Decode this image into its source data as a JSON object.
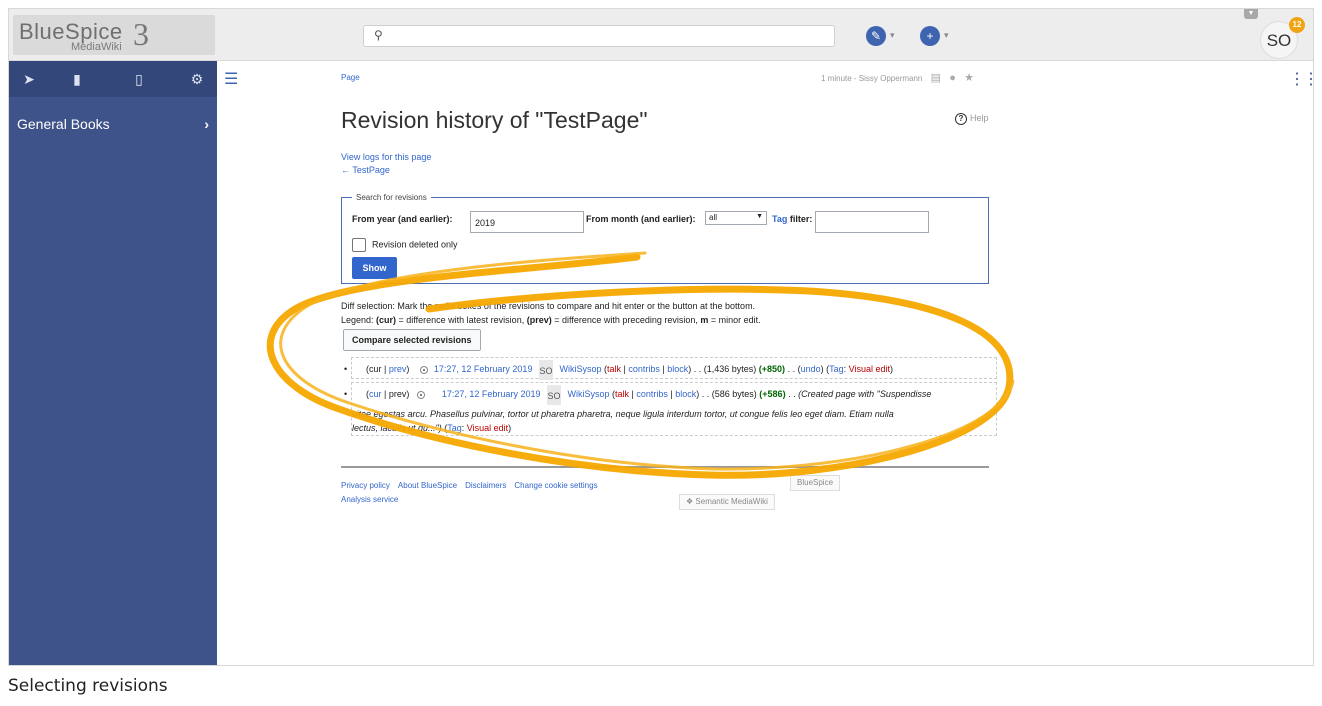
{
  "logo": {
    "text": "BlueSpice",
    "sub": "MediaWiki",
    "version": "3"
  },
  "header": {
    "search_icon": "search-icon",
    "user_initials": "SO",
    "notifications": "12"
  },
  "sidebar": {
    "tabs": [
      "navigation-icon",
      "book-icon",
      "clipboard-icon",
      "gear-icon"
    ],
    "group_label": "General Books"
  },
  "page": {
    "breadcrumb": "Page",
    "meta": "1 minute - Sissy Oppermann",
    "title": "Revision history of \"TestPage\"",
    "help": "Help",
    "view_logs": "View logs for this page",
    "back_link": "← TestPage"
  },
  "search_form": {
    "legend": "Search for revisions",
    "year_label": "From year (and earlier):",
    "year_value": "2019",
    "month_label": "From month (and earlier):",
    "month_value": "all",
    "tag_link": "Tag",
    "tag_label": "filter:",
    "tag_value": "",
    "deleted_only": "Revision deleted only",
    "show_button": "Show"
  },
  "legend_text": {
    "line1": "Diff selection: Mark the radio boxes of the revisions to compare and hit enter or the button at the bottom.",
    "line2a": "Legend: ",
    "cur": "(cur)",
    "line2b": " = difference with latest revision, ",
    "prev": "(prev)",
    "line2c": " = difference with preceding revision, ",
    "m": "m",
    "line2d": " = minor edit."
  },
  "compare_button": "Compare selected revisions",
  "revisions": [
    {
      "cur": "cur",
      "prev": "prev",
      "date": "17:27, 12 February 2019",
      "avatar": "SO",
      "user": "WikiSysop",
      "talk": "talk",
      "contribs": "contribs",
      "block": "block",
      "size": "(1,436 bytes)",
      "diff": "(+850)",
      "undo": "undo",
      "tag_label": "Tag",
      "tag": "Visual edit"
    },
    {
      "cur": "cur",
      "prev": "prev",
      "date": "17:27, 12 February 2019",
      "avatar": "SO",
      "user": "WikiSysop",
      "talk": "talk",
      "contribs": "contribs",
      "block": "block",
      "size": "(586 bytes)",
      "diff": "(+586)",
      "summary1": "(Created page with \"Suspendisse",
      "summary2": "vitae egestas arcu. Phasellus pulvinar, tortor ut pharetra pharetra, neque ligula interdum tortor, ut congue felis leo eget diam. Etiam nulla",
      "summary3": "lectus, iaculis ut qu...\")",
      "tag_label": "Tag",
      "tag": "Visual edit"
    }
  ],
  "footer": {
    "links": [
      "Privacy policy",
      "About BlueSpice",
      "Disclaimers",
      "Change cookie settings"
    ],
    "analysis": "Analysis service",
    "powered_bluespice": "BlueSpice",
    "powered_smw": "Semantic MediaWiki"
  },
  "caption": "Selecting revisions",
  "colors": {
    "sidebar": "#3e5389",
    "accent": "#3366cc",
    "annotation": "#f5a800"
  }
}
